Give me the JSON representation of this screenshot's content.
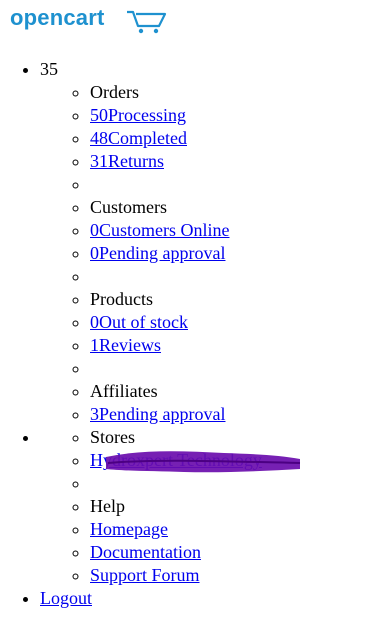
{
  "logo": {
    "text": "opencart",
    "icon": "shopping-cart-icon",
    "color": "#1e91cf"
  },
  "alerts": {
    "count": "35",
    "orders": {
      "header": "Orders",
      "items": [
        {
          "count": "50",
          "label": "Processing"
        },
        {
          "count": "48",
          "label": "Completed"
        },
        {
          "count": "31",
          "label": "Returns"
        }
      ]
    },
    "customers": {
      "header": "Customers",
      "items": [
        {
          "count": "0",
          "label": "Customers Online"
        },
        {
          "count": "0",
          "label": "Pending approval"
        }
      ]
    },
    "products": {
      "header": "Products",
      "items": [
        {
          "count": "0",
          "label": "Out of stock"
        },
        {
          "count": "1",
          "label": "Reviews"
        }
      ]
    },
    "affiliates": {
      "header": "Affiliates",
      "items": [
        {
          "count": "3",
          "label": "Pending approval"
        }
      ]
    }
  },
  "stores": {
    "header": "Stores",
    "store_link": "Hydroxpert Technology",
    "redaction_color": "#6a0dad"
  },
  "help": {
    "header": "Help",
    "links": [
      "Homepage",
      "Documentation",
      "Support Forum"
    ]
  },
  "logout": "Logout"
}
